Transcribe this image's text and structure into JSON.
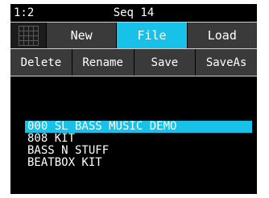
{
  "status": {
    "position": "1:2",
    "sequence": "Seq 14"
  },
  "toolbar": {
    "grid_icon": "grid-icon",
    "tabs": [
      {
        "label": "New",
        "active": false
      },
      {
        "label": "File",
        "active": true
      },
      {
        "label": "Load",
        "active": false
      }
    ]
  },
  "actions": {
    "delete": "Delete",
    "rename": "Rename",
    "save": "Save",
    "save_as": "SaveAs"
  },
  "files": [
    "000 SL BASS MUSIC DEMO",
    "808 KIT",
    "BASS N STUFF",
    "BEATBOX KIT"
  ],
  "selected_index": 0,
  "colors": {
    "accent": "#17c1e8",
    "background": "#000000",
    "button": "#3a3a3a"
  }
}
